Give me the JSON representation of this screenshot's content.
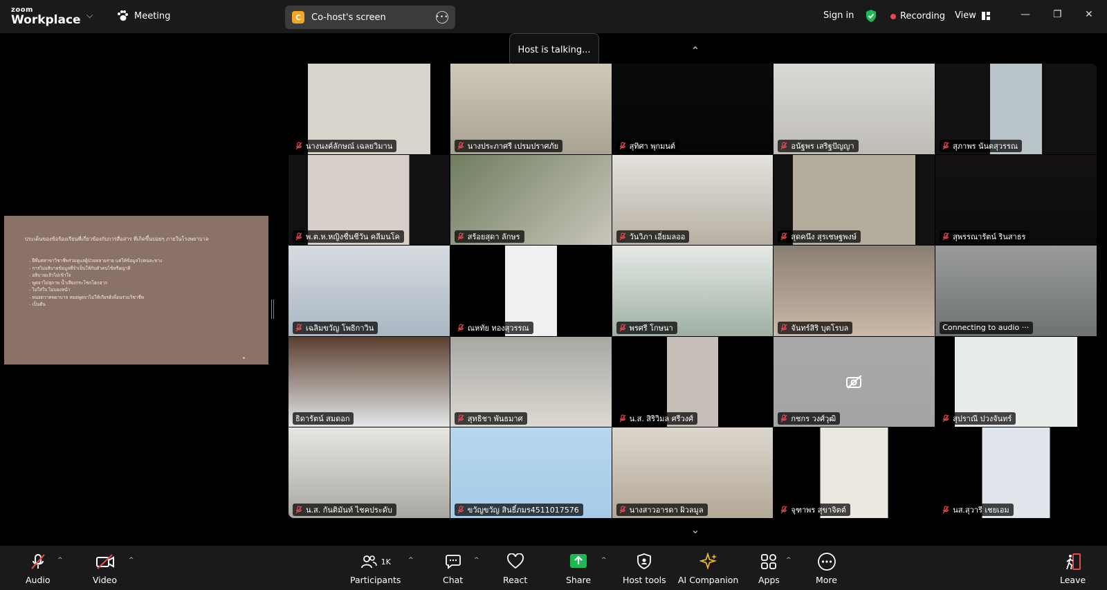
{
  "topbar": {
    "brand_small": "zoom",
    "brand_large": "Workplace",
    "meeting_label": "Meeting",
    "cohost_badge": "C",
    "cohost_title": "Co-host's screen",
    "signin": "Sign in",
    "recording": "Recording",
    "view": "View"
  },
  "host_talking": "Host is talking...",
  "slide": {
    "title": "ประเด็นของข้อร้องเรียนที่เกี่ยวข้องกับการสื่อสาร ที่เกิดขึ้นบ่อยๆ ภายในโรงพยาบาล",
    "bullets": [
      "ฝีที่มศสาขาวิชาชีพร่วมดูแลผู้ป่วยหลายราย แต่ให้ข้อมูลไปคนละทาง",
      "การไม่อธิบายข้อมูลที่จำเป็นให้กับตัวคนไข้หรือญาติ",
      "อธิบายแล้วไม่เข้าใจ",
      "พูดจาไม่สุภาพ น้ำเสียงกระโชกโฮกฮาก",
      "ไม่ใส่ใจ ไม่มองหน้า",
      "หมอดวาคพยาบาล หมอพูดจาไม่ให้เกียรติเพื่อนร่วมวิชาชีพ",
      "เป็นต้น"
    ]
  },
  "participants": [
    {
      "name": "นางนงค์ลักษณ์ เฉลยวิมาน",
      "muted": true
    },
    {
      "name": "นางประภาศรี  เปรมปราศภัย",
      "muted": true
    },
    {
      "name": "สุทิศา พุกมนต์",
      "muted": true
    },
    {
      "name": "อนัฐพร เสริฐปัญญา",
      "muted": true
    },
    {
      "name": "สุภาพร นันตสุวรรณ",
      "muted": true
    },
    {
      "name": "พ.ต.ห.หญิงชื่นชีวัน คลีมนโค",
      "muted": true
    },
    {
      "name": "สร้อยสุดา ลักษร",
      "muted": true
    },
    {
      "name": "วันวิภา  เอี่ยมลออ",
      "muted": true
    },
    {
      "name": "สุดคนึง สุรเชษฐพงษ์",
      "muted": true
    },
    {
      "name": "สุพรรณารัตน์ รินสาธร",
      "muted": true
    },
    {
      "name": "เฉลิมขวัญ  โพธิกาวิน",
      "muted": true
    },
    {
      "name": "ณหทัย ทองสุวรรณ",
      "muted": true
    },
    {
      "name": "พรศรี  โกษนา",
      "muted": true
    },
    {
      "name": "จันทร์สิริ บุตโรบล",
      "muted": true
    },
    {
      "name": "Connecting to audio ···",
      "muted": false
    },
    {
      "name": "ธิดารัตน์ สมดอก",
      "muted": false
    },
    {
      "name": "สุทธิชา พันธมาศ",
      "muted": true
    },
    {
      "name": "น.ส. สิริวิมล ศรีวงศ์",
      "muted": true
    },
    {
      "name": "กชกร วงศ์วุฒิ",
      "muted": true
    },
    {
      "name": "สุปราณี ปวงจันทร์",
      "muted": true
    },
    {
      "name": "น.ส. กันติมันท์ ไชคประดับ",
      "muted": true
    },
    {
      "name": "ขวัญขวัญ สินธิ์ภมร4511017576",
      "muted": true
    },
    {
      "name": "นางสาวอารดา ผิวลมูล",
      "muted": true
    },
    {
      "name": "จุฑาพร สุขาจิตต์",
      "muted": true
    },
    {
      "name": "นส.สุวารี  เชยเอม",
      "muted": true
    }
  ],
  "toolbar": {
    "audio": "Audio",
    "video": "Video",
    "participants": "Participants",
    "participants_count": "1K",
    "chat": "Chat",
    "react": "React",
    "share": "Share",
    "host_tools": "Host tools",
    "ai_companion": "AI Companion",
    "apps": "Apps",
    "more": "More",
    "leave": "Leave"
  },
  "colors": {
    "share_green": "#1db954",
    "leave_red": "#e5484d",
    "mic_off_red": "#e5484d",
    "ai_gold": "#f0b429",
    "slide_bg": "#8a7268"
  }
}
